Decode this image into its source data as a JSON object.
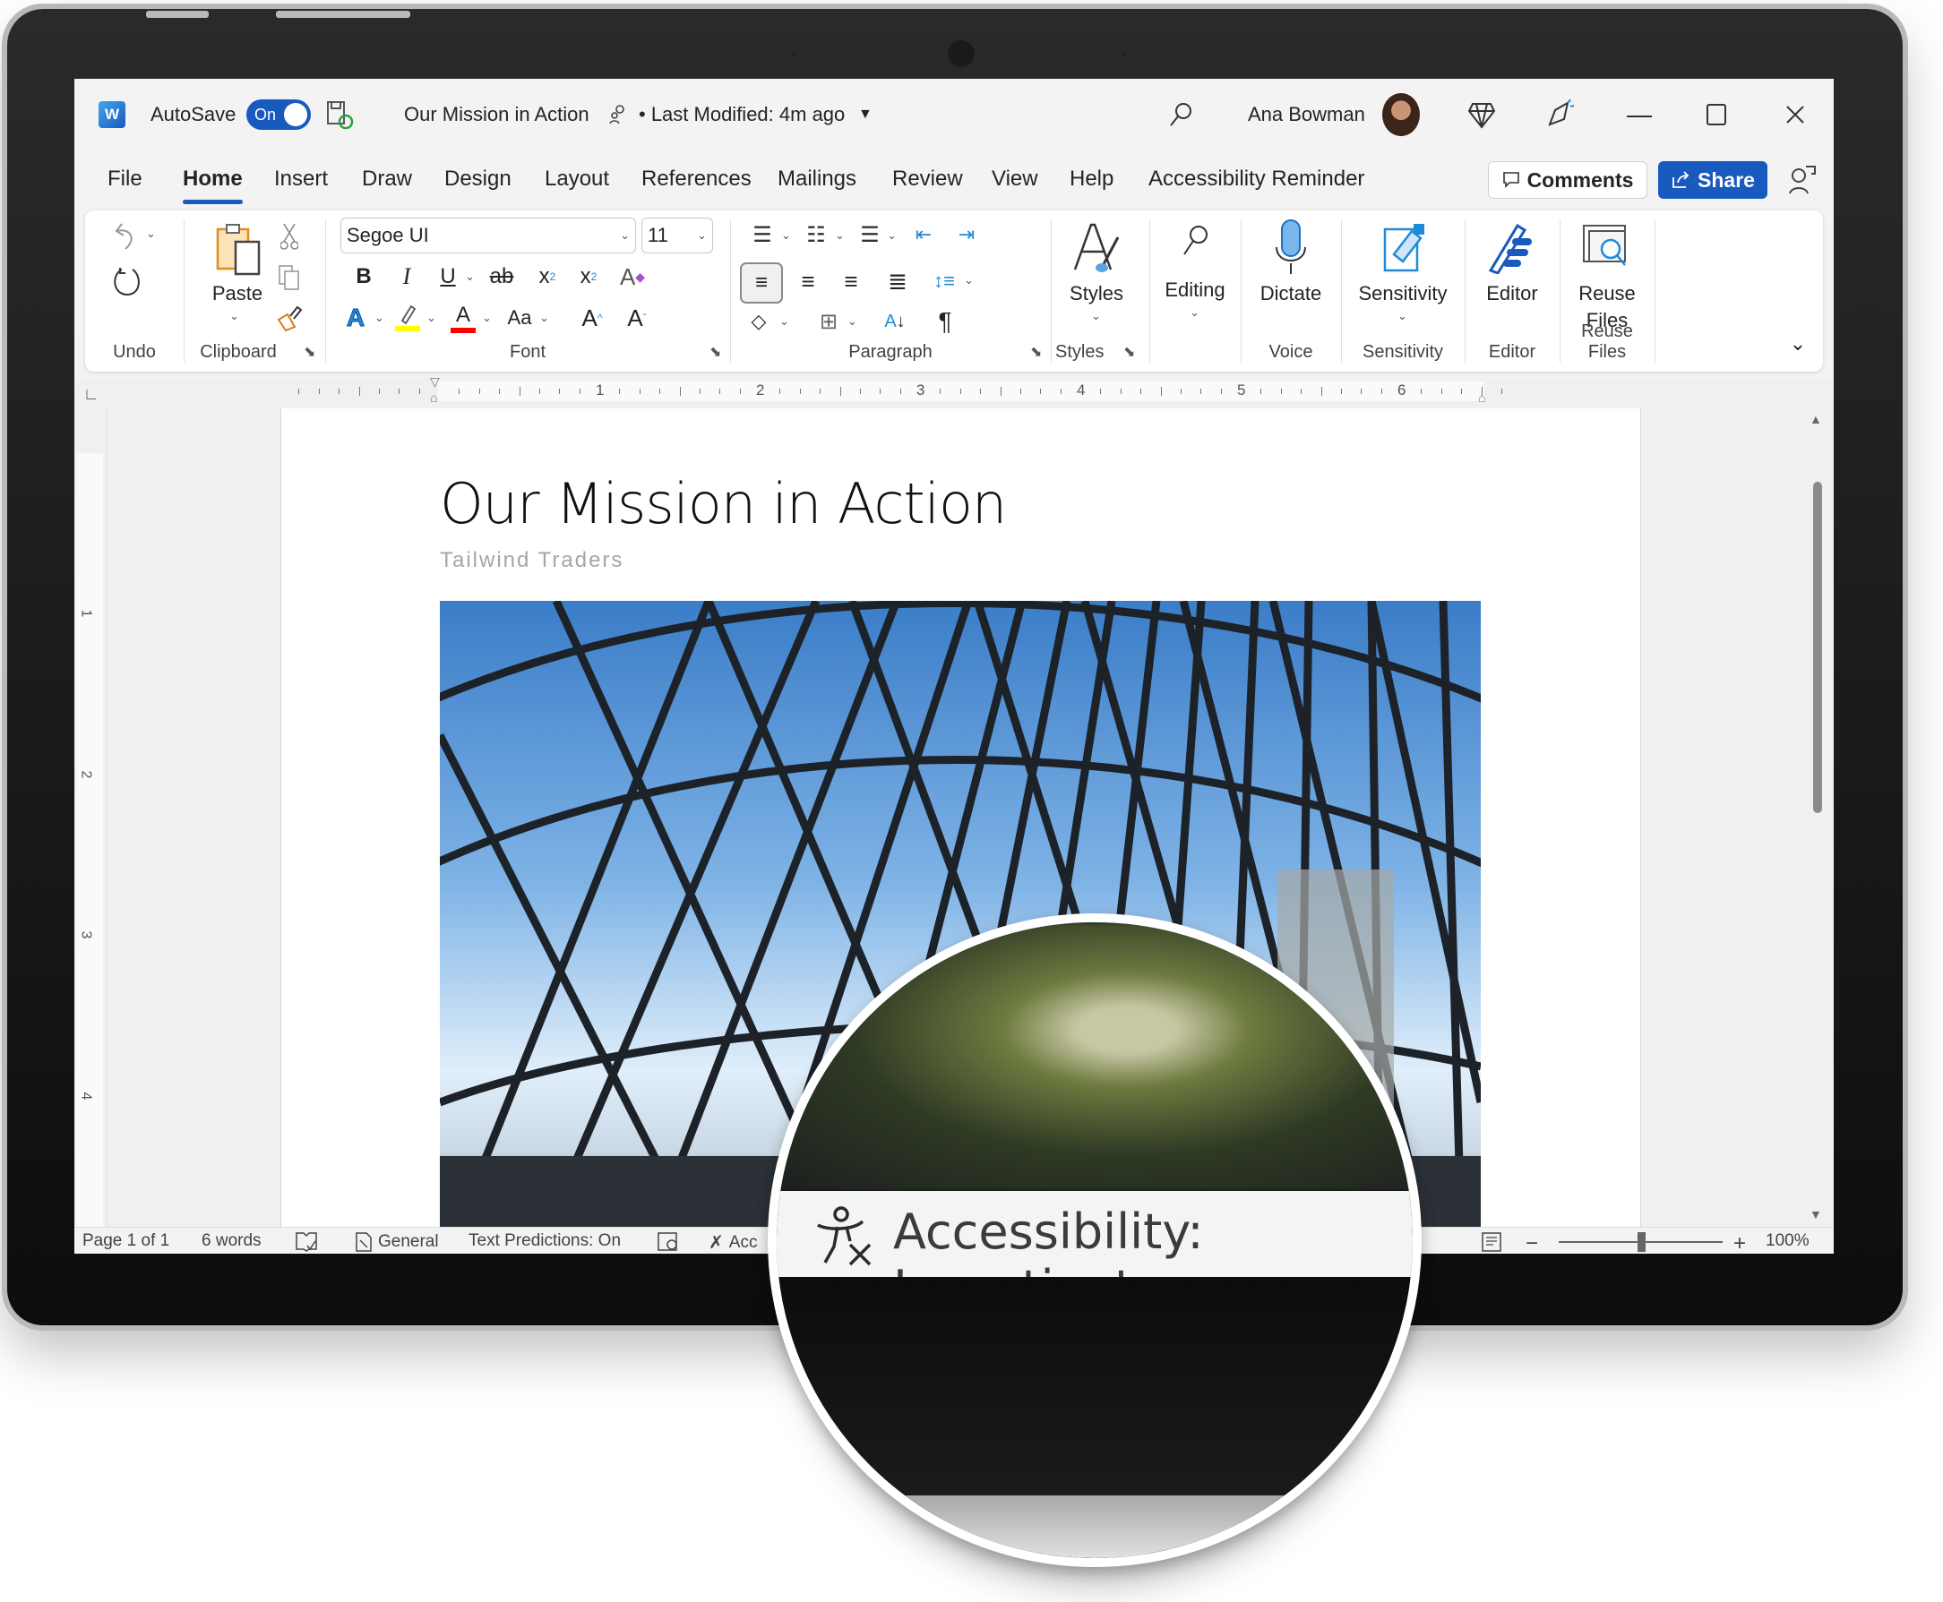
{
  "app": {
    "logo_letter": "W",
    "autosave_label": "AutoSave",
    "autosave_state": "On",
    "doc_title": "Our Mission in Action",
    "last_modified": "• Last Modified: 4m ago",
    "user_name": "Ana Bowman"
  },
  "tabs": [
    "File",
    "Home",
    "Insert",
    "Draw",
    "Design",
    "Layout",
    "References",
    "Mailings",
    "Review",
    "View",
    "Help",
    "Accessibility Reminder"
  ],
  "active_tab": "Home",
  "actions": {
    "comments": "Comments",
    "share": "Share"
  },
  "ribbon": {
    "groups": {
      "undo": "Undo",
      "clipboard": "Clipboard",
      "font": "Font",
      "paragraph": "Paragraph",
      "styles": "Styles",
      "voice": "Voice",
      "sensitivity": "Sensitivity",
      "editor": "Editor",
      "reuse_files": "Reuse Files"
    },
    "paste": "Paste",
    "font_name": "Segoe UI",
    "font_size": "11",
    "change_case": "Aa",
    "styles_btn": "Styles",
    "editing_btn": "Editing",
    "dictate_btn": "Dictate",
    "sensitivity_btn": "Sensitivity",
    "editor_btn": "Editor",
    "reuse_btn_line1": "Reuse",
    "reuse_btn_line2": "Files",
    "colors": {
      "highlight": "#ffff00",
      "font_color": "#ff0000",
      "accent": "#185abd"
    }
  },
  "ruler": {
    "h_numbers": [
      "1",
      "2",
      "3",
      "4",
      "5",
      "6"
    ],
    "v_numbers": [
      "1",
      "2",
      "3",
      "4"
    ]
  },
  "document": {
    "title": "Our Mission in Action",
    "subtitle": "Tailwind Traders"
  },
  "status": {
    "page": "Page 1 of 1",
    "words": "6 words",
    "sensitivity": "General",
    "text_predictions": "Text Predictions: On",
    "accessibility_short": "Acc",
    "zoom": "100%",
    "zoom_percent": 100
  },
  "magnifier": {
    "text": "Accessibility: Investigate"
  }
}
